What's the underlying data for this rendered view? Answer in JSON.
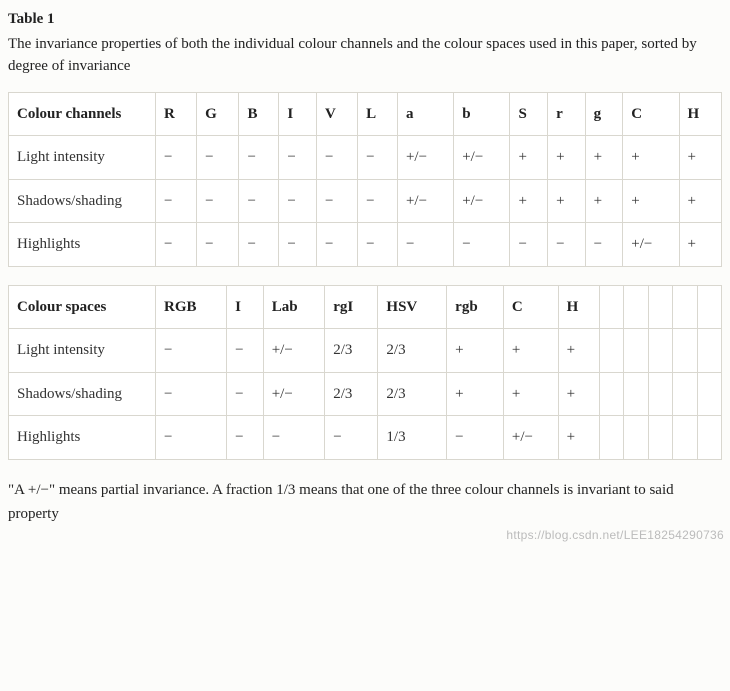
{
  "label": "Table 1",
  "caption": "The invariance properties of both the individual colour channels and the colour spaces used in this paper, sorted by degree of invariance",
  "table1": {
    "header": [
      "Colour channels",
      "R",
      "G",
      "B",
      "I",
      "V",
      "L",
      "a",
      "b",
      "S",
      "r",
      "g",
      "C",
      "H"
    ],
    "rows": [
      {
        "label": "Light intensity",
        "cells": [
          "−",
          "−",
          "−",
          "−",
          "−",
          "−",
          "+/−",
          "+/−",
          "+",
          "+",
          "+",
          "+",
          "+"
        ]
      },
      {
        "label": "Shadows/shading",
        "cells": [
          "−",
          "−",
          "−",
          "−",
          "−",
          "−",
          "+/−",
          "+/−",
          "+",
          "+",
          "+",
          "+",
          "+"
        ]
      },
      {
        "label": "Highlights",
        "cells": [
          "−",
          "−",
          "−",
          "−",
          "−",
          "−",
          "−",
          "−",
          "−",
          "−",
          "−",
          "+/−",
          "+"
        ]
      }
    ]
  },
  "table2": {
    "header": [
      "Colour spaces",
      "RGB",
      "I",
      "Lab",
      "rgI",
      "HSV",
      "rgb",
      "C",
      "H",
      "",
      "",
      "",
      "",
      ""
    ],
    "rows": [
      {
        "label": "Light intensity",
        "cells": [
          "−",
          "−",
          "+/−",
          "2/3",
          "2/3",
          "+",
          "+",
          "+",
          "",
          "",
          "",
          "",
          ""
        ]
      },
      {
        "label": "Shadows/shading",
        "cells": [
          "−",
          "−",
          "+/−",
          "2/3",
          "2/3",
          "+",
          "+",
          "+",
          "",
          "",
          "",
          "",
          ""
        ]
      },
      {
        "label": "Highlights",
        "cells": [
          "−",
          "−",
          "−",
          "−",
          "1/3",
          "−",
          "+/−",
          "+",
          "",
          "",
          "",
          "",
          ""
        ]
      }
    ]
  },
  "footnote": "\"A +/−\" means partial invariance. A fraction 1/3 means that one of the three colour channels is invariant to said property",
  "watermark": "https://blog.csdn.net/LEE18254290736",
  "chart_data": [
    {
      "type": "table",
      "title": "Colour channels invariance",
      "columns": [
        "R",
        "G",
        "B",
        "I",
        "V",
        "L",
        "a",
        "b",
        "S",
        "r",
        "g",
        "C",
        "H"
      ],
      "rows": [
        "Light intensity",
        "Shadows/shading",
        "Highlights"
      ],
      "values": [
        [
          "−",
          "−",
          "−",
          "−",
          "−",
          "−",
          "+/−",
          "+/−",
          "+",
          "+",
          "+",
          "+",
          "+"
        ],
        [
          "−",
          "−",
          "−",
          "−",
          "−",
          "−",
          "+/−",
          "+/−",
          "+",
          "+",
          "+",
          "+",
          "+"
        ],
        [
          "−",
          "−",
          "−",
          "−",
          "−",
          "−",
          "−",
          "−",
          "−",
          "−",
          "−",
          "+/−",
          "+"
        ]
      ]
    },
    {
      "type": "table",
      "title": "Colour spaces invariance",
      "columns": [
        "RGB",
        "I",
        "Lab",
        "rgI",
        "HSV",
        "rgb",
        "C",
        "H"
      ],
      "rows": [
        "Light intensity",
        "Shadows/shading",
        "Highlights"
      ],
      "values": [
        [
          "−",
          "−",
          "+/−",
          "2/3",
          "2/3",
          "+",
          "+",
          "+"
        ],
        [
          "−",
          "−",
          "+/−",
          "2/3",
          "2/3",
          "+",
          "+",
          "+"
        ],
        [
          "−",
          "−",
          "−",
          "−",
          "1/3",
          "−",
          "+/−",
          "+"
        ]
      ]
    }
  ]
}
